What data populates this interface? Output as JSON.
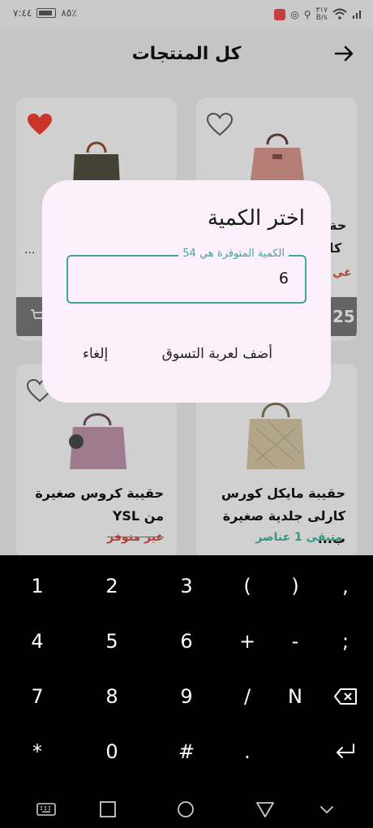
{
  "status_bar": {
    "time": "٧:٤٤",
    "battery": "٨٥٪",
    "net_speed_value": "٣١٧",
    "net_speed_unit": "B/s"
  },
  "header": {
    "title": "كل المنتجات",
    "back_icon": "arrow-right-icon"
  },
  "products": [
    {
      "name_line1": "حقيبة مايكل كورس",
      "name_line2": "كارلى جلدية صغيرة ب...",
      "stock": "متبقى 1 عناصر",
      "stock_color": "#3ea88f",
      "favorite": false
    },
    {
      "name_line1": "حقيبة كروس صغيرة",
      "name_line2": "من YSL",
      "stock": "غير متوفر",
      "stock_color": "#c24a3e",
      "favorite": false
    }
  ],
  "partial": {
    "top_right_name": "حة",
    "top_right_name2": "كا",
    "top_right_stock": "غي",
    "top_right_price": "25",
    "top_left_name": "..."
  },
  "dialog": {
    "title": "اختر الكمية",
    "field_label": "الكمية المتوفرة هي 54",
    "field_value": "6",
    "add_button": "أضف لعربة التسوق",
    "cancel_button": "إلغاء"
  },
  "keyboard": {
    "rows": [
      [
        "1",
        "2",
        "3",
        "(",
        ")",
        ","
      ],
      [
        "4",
        "5",
        "6",
        "+",
        "-",
        ";"
      ],
      [
        "7",
        "8",
        "9",
        "/",
        "N",
        "⌫"
      ],
      [
        "*",
        "0",
        "#",
        ".",
        "↵"
      ]
    ]
  },
  "colors": {
    "accent": "#3ea88f",
    "heart_active": "#e33b2e",
    "dialog_bg": "#fcf0fc"
  }
}
